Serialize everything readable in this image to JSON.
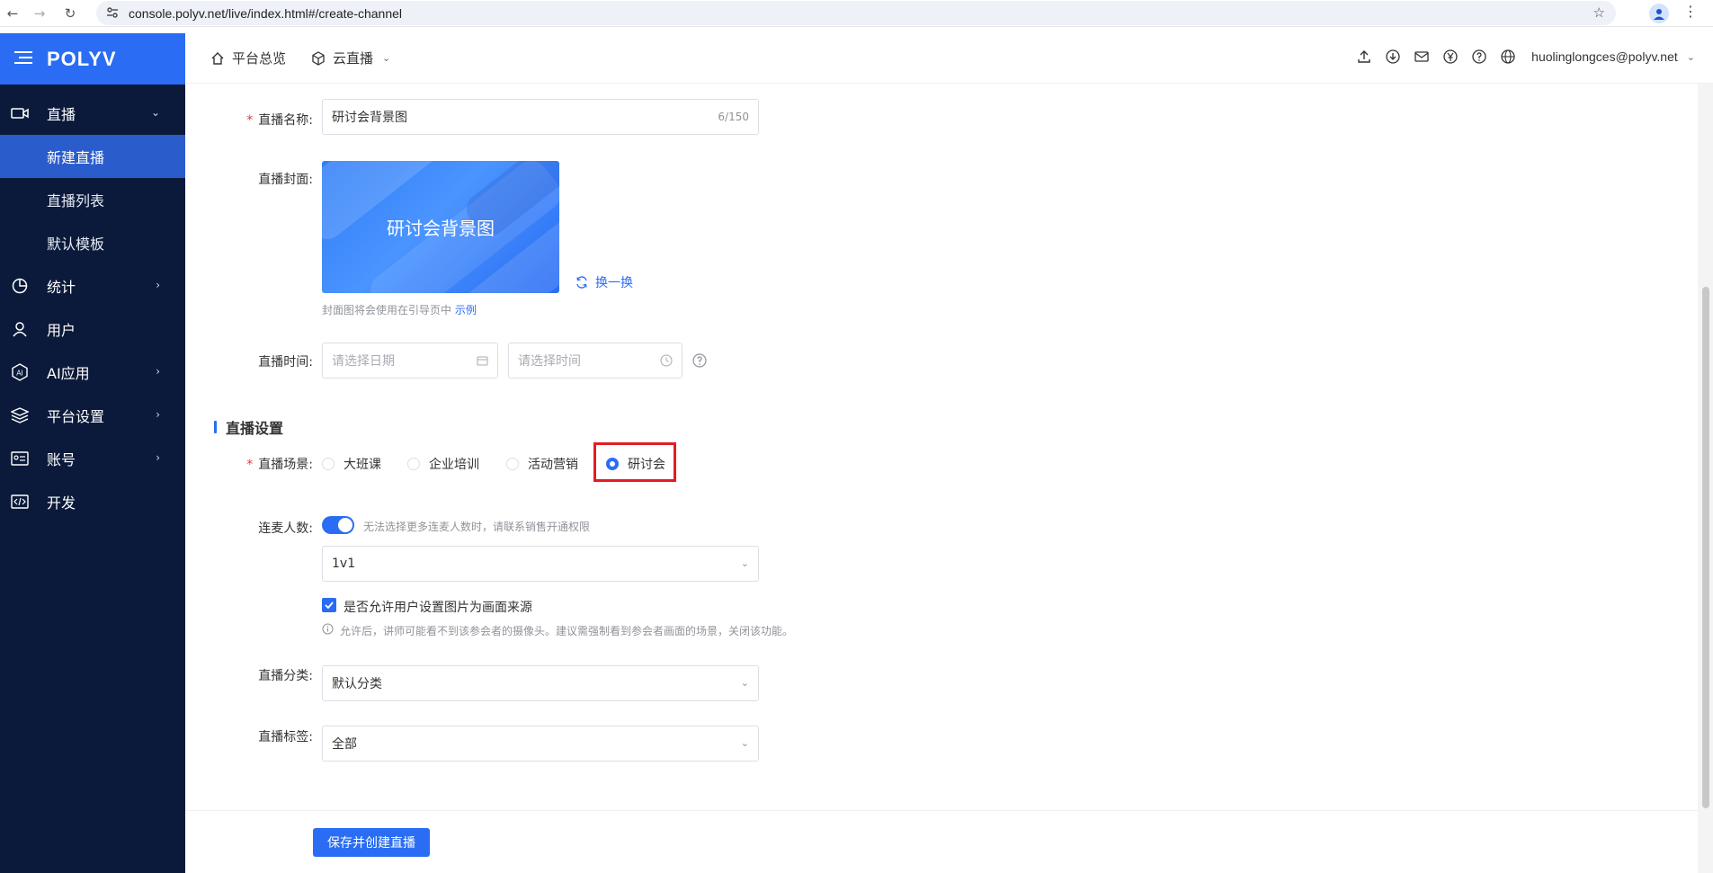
{
  "browser": {
    "url": "console.polyv.net/live/index.html#/create-channel"
  },
  "sidebar": {
    "brand": "POLYV",
    "items": [
      {
        "label": "直播",
        "icon": "video-icon",
        "expanded": true
      },
      {
        "label": "统计",
        "icon": "pie-chart-icon"
      },
      {
        "label": "用户",
        "icon": "user-icon"
      },
      {
        "label": "AI应用",
        "icon": "ai-icon"
      },
      {
        "label": "平台设置",
        "icon": "layers-icon"
      },
      {
        "label": "账号",
        "icon": "id-card-icon"
      },
      {
        "label": "开发",
        "icon": "code-icon"
      }
    ],
    "sub_items": [
      {
        "label": "新建直播",
        "active": true
      },
      {
        "label": "直播列表"
      },
      {
        "label": "默认模板"
      }
    ]
  },
  "topbar": {
    "overview": "平台总览",
    "cloud_live": "云直播",
    "email": "huolinglongces@polyv.net"
  },
  "form": {
    "name_label": "直播名称:",
    "name_value": "研讨会背景图",
    "name_counter": "6/150",
    "cover_label": "直播封面:",
    "cover_title": "研讨会背景图",
    "swap_label": "换一换",
    "cover_hint": "封面图将会使用在引导页中",
    "cover_example": "示例",
    "time_label": "直播时间:",
    "date_placeholder": "请选择日期",
    "time_placeholder": "请选择时间"
  },
  "settings": {
    "section_title": "直播设置",
    "scene_label": "直播场景:",
    "scenes": [
      "大班课",
      "企业培训",
      "活动营销",
      "研讨会"
    ],
    "selected_scene": "研讨会",
    "mic_label": "连麦人数:",
    "mic_hint": "无法选择更多连麦人数时，请联系销售开通权限",
    "mic_value": "1v1",
    "mic_enabled": true,
    "allow_image_label": "是否允许用户设置图片为画面来源",
    "allow_image_checked": true,
    "allow_image_hint": "允许后，讲师可能看不到该参会者的摄像头。建议需强制看到参会者画面的场景，关闭该功能。",
    "category_label": "直播分类:",
    "category_value": "默认分类",
    "tag_label": "直播标签:",
    "tag_value": "全部"
  },
  "footer": {
    "submit_label": "保存并创建直播"
  },
  "colors": {
    "primary": "#2a6df4",
    "sidebar_bg": "#0b1a3a",
    "highlight": "#e41c24"
  }
}
